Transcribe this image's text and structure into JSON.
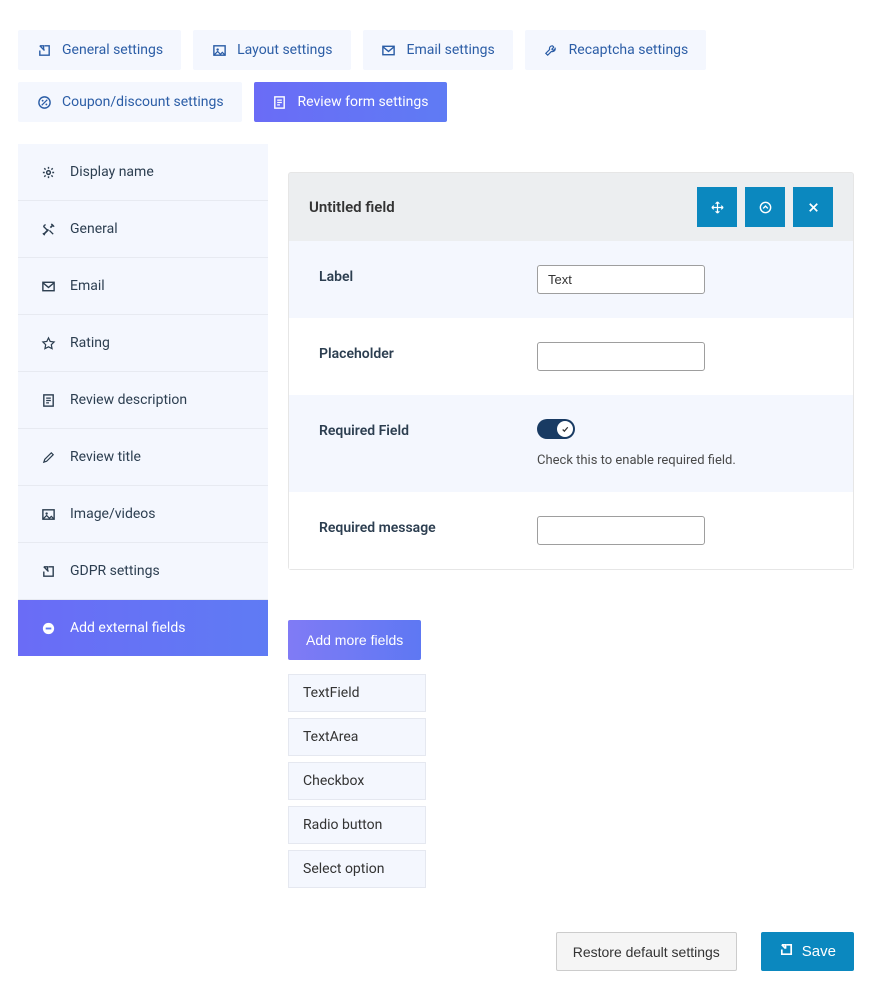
{
  "tabs": [
    {
      "label": "General settings",
      "icon": "external"
    },
    {
      "label": "Layout settings",
      "icon": "image"
    },
    {
      "label": "Email settings",
      "icon": "mail"
    },
    {
      "label": "Recaptcha settings",
      "icon": "wrench"
    },
    {
      "label": "Coupon/discount settings",
      "icon": "percent"
    },
    {
      "label": "Review form settings",
      "icon": "form",
      "active": true
    }
  ],
  "sidebar": [
    {
      "label": "Display name",
      "icon": "gear"
    },
    {
      "label": "General",
      "icon": "tools"
    },
    {
      "label": "Email",
      "icon": "mail"
    },
    {
      "label": "Rating",
      "icon": "star"
    },
    {
      "label": "Review description",
      "icon": "form"
    },
    {
      "label": "Review title",
      "icon": "pencil"
    },
    {
      "label": "Image/videos",
      "icon": "image"
    },
    {
      "label": "GDPR settings",
      "icon": "external"
    },
    {
      "label": "Add external fields",
      "icon": "minus",
      "active": true
    }
  ],
  "field": {
    "title": "Untitled field",
    "label_title": "Label",
    "label_value": "Text",
    "placeholder_title": "Placeholder",
    "placeholder_value": "",
    "required_title": "Required Field",
    "required_on": true,
    "required_hint": "Check this to enable required field.",
    "required_msg_title": "Required message",
    "required_msg_value": ""
  },
  "add_more": {
    "button": "Add more fields",
    "options": [
      "TextField",
      "TextArea",
      "Checkbox",
      "Radio button",
      "Select option"
    ]
  },
  "footer": {
    "restore": "Restore default settings",
    "save": "Save"
  }
}
